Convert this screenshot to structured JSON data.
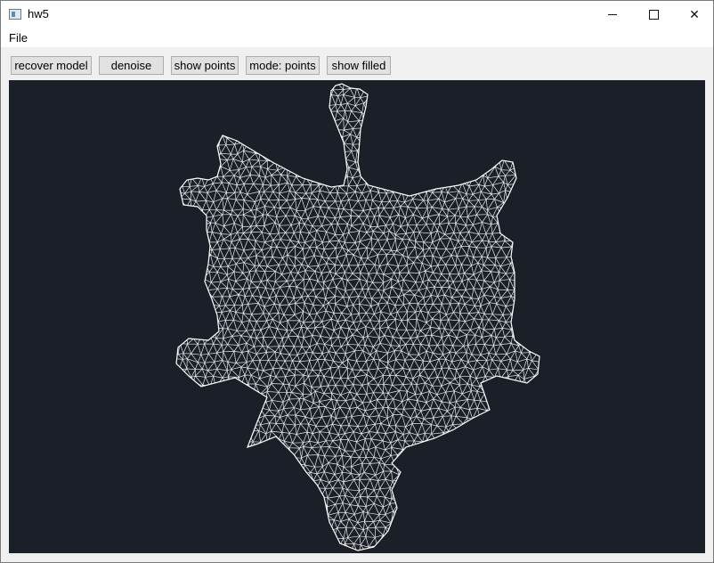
{
  "window": {
    "title": "hw5",
    "icon": "app-window-icon"
  },
  "window_controls": {
    "minimize": "minimize-icon",
    "maximize": "maximize-icon",
    "close": "close-icon"
  },
  "menu": {
    "items": [
      {
        "label": "File"
      }
    ]
  },
  "toolbar": {
    "recover_label": "recover model",
    "denoise_label": "denoise",
    "show_points_label": "show points",
    "mode_label": "mode: points",
    "show_filled_label": "show filled"
  },
  "viewport": {
    "background": "#1b2028",
    "mesh_color": "#ffffff",
    "content": "white triangle wireframe mesh"
  }
}
